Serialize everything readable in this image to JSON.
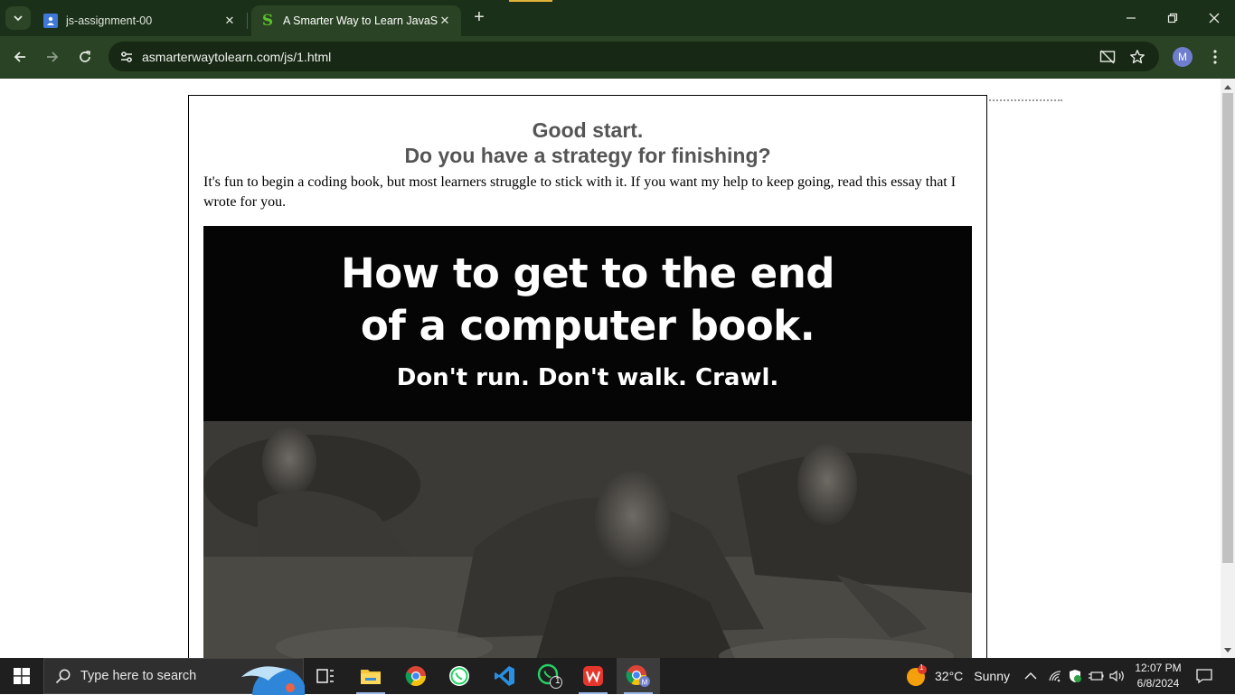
{
  "browser": {
    "tabs": [
      {
        "title": "js-assignment-00",
        "favicon": "classroom-icon",
        "active": false
      },
      {
        "title": "A Smarter Way to Learn JavaScript",
        "favicon": "smarter-way-s-icon",
        "active": true
      }
    ],
    "url": "asmarterwaytolearn.com/js/1.html",
    "profile_initial": "M",
    "theme_colors": {
      "frame": "#1b3018",
      "toolbar": "#2a4324",
      "omnibox": "#172814"
    }
  },
  "page": {
    "heading_line1": "Good start.",
    "heading_line2": "Do you have a strategy for finishing?",
    "intro": "It's fun to begin a coding book, but most learners struggle to stick with it. If you want my help to keep going, read this essay that I wrote for you.",
    "banner": {
      "line1": "How to get to the end",
      "line2": "of a computer book.",
      "subline": "Don't run. Don't walk. Crawl."
    }
  },
  "taskbar": {
    "search_placeholder": "Type here to search",
    "apps": [
      "task-view-icon",
      "file-explorer-icon",
      "chrome-icon",
      "whatsapp-icon",
      "vscode-icon",
      "whatsapp-business-icon",
      "wps-office-icon",
      "chrome-profile-icon"
    ],
    "whatsapp_badge": "1",
    "weather_badge": "1",
    "weather_temp": "32°C",
    "weather_text": "Sunny",
    "time": "12:07 PM",
    "date": "6/8/2024"
  }
}
